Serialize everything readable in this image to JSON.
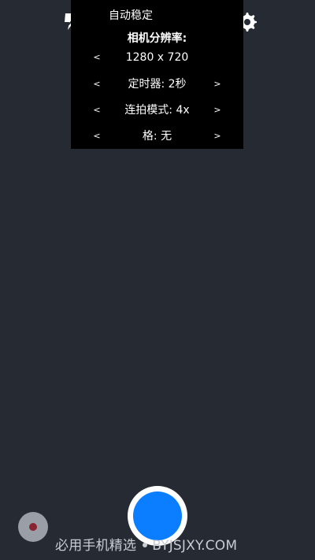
{
  "settings": {
    "title": "自动稳定",
    "subtitle": "相机分辨率:",
    "resolution": {
      "prev": "<",
      "value": "1280 x 720",
      "next": ""
    },
    "timer": {
      "prev": "<",
      "value": "定时器: 2秒",
      "next": ">"
    },
    "burst": {
      "prev": "<",
      "value": "连拍模式: 4x",
      "next": ">"
    },
    "grid": {
      "prev": "<",
      "value": "格: 无",
      "next": ">"
    }
  },
  "icons": {
    "flash": "flash-off-icon",
    "mode": "camera-mode-icon",
    "hdr": "hdr-icon",
    "settings": "gear-icon",
    "gallery": "gallery-icon"
  },
  "colors": {
    "background": "#262b33",
    "panel": "#000000",
    "shutter": "#0b7dff",
    "gallery_dot": "#8b2432"
  },
  "watermark": {
    "left": "必用手机精选",
    "right": "BYJSJXY.COM"
  }
}
